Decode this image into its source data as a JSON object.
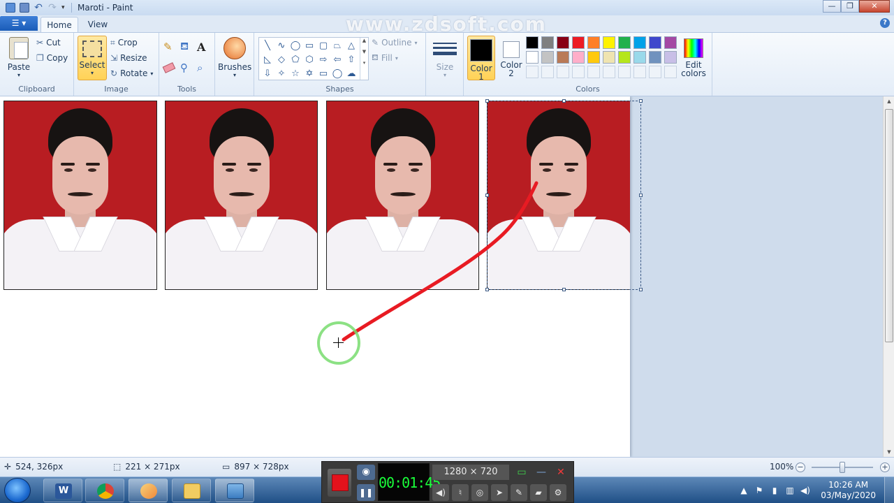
{
  "window": {
    "title": "Maroti - Paint",
    "watermark": "www.zdsoft.com"
  },
  "menu": {
    "file_label": "▾",
    "tabs": [
      "Home",
      "View"
    ],
    "help": "?"
  },
  "ribbon": {
    "clipboard": {
      "label": "Clipboard",
      "paste": "Paste",
      "cut": "Cut",
      "copy": "Copy"
    },
    "image": {
      "label": "Image",
      "select": "Select",
      "crop": "Crop",
      "resize": "Resize",
      "rotate": "Rotate"
    },
    "tools": {
      "label": "Tools"
    },
    "brushes": {
      "label": "Brushes"
    },
    "shapes": {
      "label": "Shapes",
      "outline": "Outline",
      "fill": "Fill"
    },
    "size": {
      "label": "Size"
    },
    "colors": {
      "label": "Colors",
      "color1_a": "Color",
      "color1_b": "1",
      "color2_a": "Color",
      "color2_b": "2",
      "edit_a": "Edit",
      "edit_b": "colors",
      "color1_value": "#000000",
      "color2_value": "#ffffff",
      "palette": [
        "#000000",
        "#7f7f7f",
        "#880015",
        "#ed1c24",
        "#ff7f27",
        "#fff200",
        "#22b14c",
        "#00a2e8",
        "#3f48cc",
        "#a349a4",
        "#ffffff",
        "#c3c3c3",
        "#b97a57",
        "#ffaec9",
        "#ffc90e",
        "#efe4b0",
        "#b5e61d",
        "#99d9ea",
        "#7092be",
        "#c8bfe7"
      ]
    }
  },
  "status": {
    "cursor_pos": "524, 326px",
    "selection_size": "221 × 271px",
    "image_size": "897 × 728px",
    "zoom": "100%"
  },
  "recorder": {
    "timer": "00:01:45",
    "resolution": "1280 × 720"
  },
  "taskbar": {
    "time": "10:26 AM",
    "date": "03/May/2020"
  }
}
